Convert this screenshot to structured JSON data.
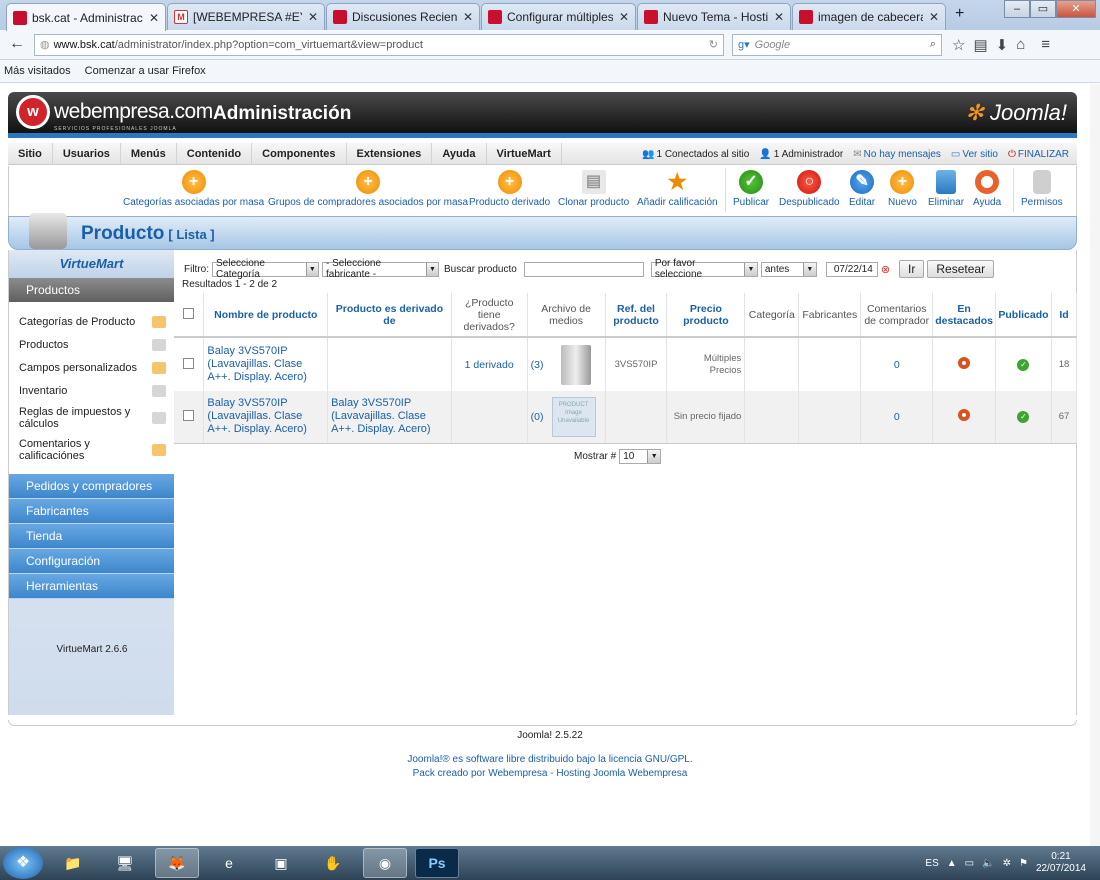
{
  "browser": {
    "tabs": [
      {
        "title": "bsk.cat - Administrac...",
        "active": true,
        "icon": "webempresa-favicon-icon"
      },
      {
        "title": "[WEBEMPRESA #EYF-...",
        "active": false,
        "icon": "gmail-favicon-icon"
      },
      {
        "title": "Discusiones Reciente...",
        "active": false,
        "icon": "webempresa-favicon-icon"
      },
      {
        "title": "Configurar múltiples ...",
        "active": false,
        "icon": "webempresa-favicon-icon"
      },
      {
        "title": "Nuevo Tema - Hostin...",
        "active": false,
        "icon": "webempresa-favicon-icon"
      },
      {
        "title": "imagen de cabecera ...",
        "active": false,
        "icon": "webempresa-favicon-icon"
      }
    ],
    "url_host": "www.bsk.cat",
    "url_path": "/administrator/index.php?option=com_virtuemart&view=product",
    "search_placeholder": "Google",
    "bookmarks": [
      "Más visitados",
      "Comenzar a usar Firefox"
    ]
  },
  "header": {
    "logo_text": "webempresa.com",
    "logo_sub": "SERVICIOS PROFESIONALES JOOMLA",
    "title": "Administración",
    "joomla": "Joomla!"
  },
  "menu": {
    "items": [
      "Sitio",
      "Usuarios",
      "Menús",
      "Contenido",
      "Componentes",
      "Extensiones",
      "Ayuda",
      "VirtueMart"
    ],
    "status": {
      "connected": "1 Conectados al sitio",
      "admins": "1 Administrador",
      "messages": "No hay mensajes",
      "view_site": "Ver sitio",
      "logout": "FINALIZAR"
    }
  },
  "toolbar": {
    "buttons": [
      "Categorías asociadas por masa",
      "Grupos de compradores asociados por masa",
      "Producto derivado",
      "Clonar producto",
      "Añadir calificación",
      "Publicar",
      "Despublicado",
      "Editar",
      "Nuevo",
      "Eliminar",
      "Ayuda",
      "Permisos"
    ]
  },
  "page": {
    "title": "Producto",
    "subtitle": "[ Lista ]"
  },
  "sidebar": {
    "logo": "VirtueMart",
    "section": "Productos",
    "items": [
      "Categorías de Producto",
      "Productos",
      "Campos personalizados",
      "Inventario",
      "Reglas de impuestos y cálculos",
      "Comentarios y calificaciónes"
    ],
    "groups": [
      "Pedidos y compradores",
      "Fabricantes",
      "Tienda",
      "Configuración",
      "Herramientas"
    ],
    "version": "VirtueMart 2.6.6"
  },
  "filters": {
    "label": "Filtro:",
    "category": "Seleccione Categoría",
    "manufacturer": "- Seleccione fabricante -",
    "search_label": "Buscar producto",
    "search_value": "",
    "please_select": "Por favor seleccione",
    "before": "antes",
    "date": "07/22/14",
    "go": "Ir",
    "reset": "Resetear",
    "results": "Resultados 1 - 2 de 2"
  },
  "table": {
    "headers": [
      "Nombre de producto",
      "Producto es derivado de",
      "¿Producto tiene derivados?",
      "Archivo de medios",
      "Ref. del producto",
      "Precio producto",
      "Categoría",
      "Fabricantes",
      "Comentarios de comprador",
      "En destacados",
      "Publicado",
      "Id"
    ],
    "rows": [
      {
        "name": "Balay 3VS570IP (Lavavajillas. Clase A++. Display. Acero)",
        "parent": "",
        "children": "1 derivado",
        "media": "(3)",
        "sku": "3VS570IP",
        "price": "Múltiples Precios",
        "category": "",
        "manufacturer": "",
        "reviews": "0",
        "id": "18"
      },
      {
        "name": "Balay 3VS570IP (Lavavajillas. Clase A++. Display. Acero)",
        "parent": "Balay 3VS570IP (Lavavajillas. Clase A++. Display. Acero)",
        "children": "",
        "media": "(0)",
        "media_placeholder": "PRODUCT Image Unavailable",
        "sku": "",
        "price": "Sin precio fijado",
        "category": "",
        "manufacturer": "",
        "reviews": "0",
        "id": "67"
      }
    ],
    "show_label": "Mostrar #",
    "show_value": "10"
  },
  "footer": {
    "version": "Joomla! 2.5.22",
    "license": "Joomla!® es software libre distribuido bajo la licencia GNU/GPL.",
    "pack": "Pack creado por Webempresa - Hosting Joomla Webempresa"
  },
  "taskbar": {
    "lang": "ES",
    "time": "0:21",
    "date": "22/07/2014"
  }
}
